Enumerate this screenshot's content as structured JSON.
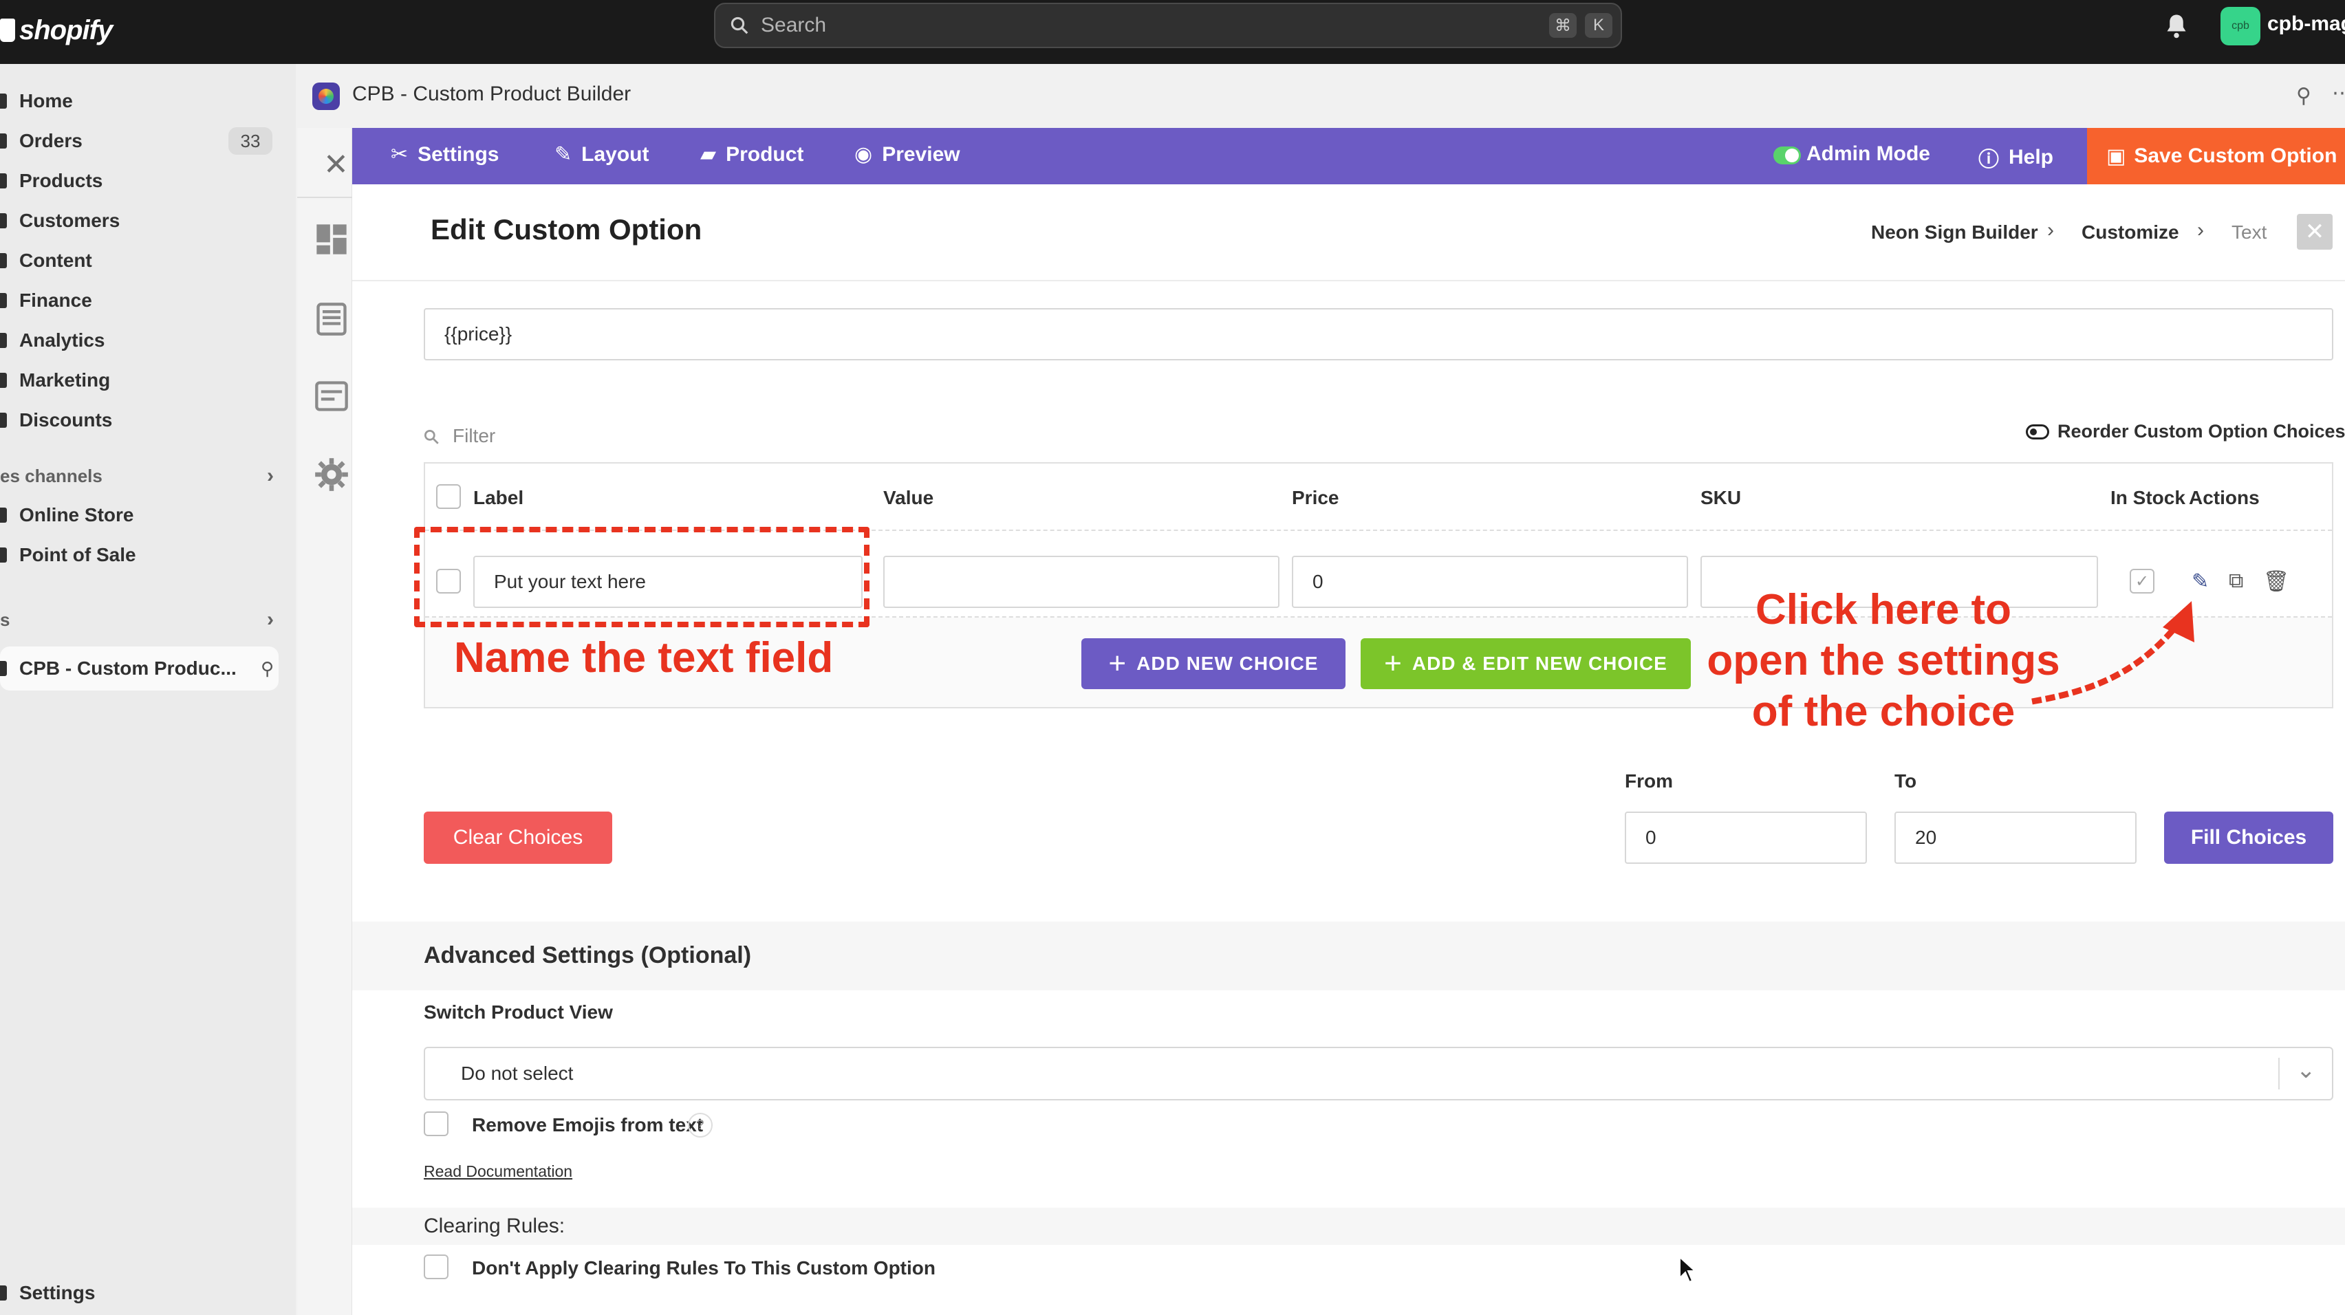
{
  "topbar": {
    "logo": "shopify",
    "search_placeholder": "Search",
    "shortcut_keys": [
      "⌘",
      "K"
    ],
    "avatar_initials": "cpb",
    "store_name": "cpb-mago"
  },
  "nav": {
    "items": [
      {
        "label": "Home"
      },
      {
        "label": "Orders",
        "badge": "33"
      },
      {
        "label": "Products"
      },
      {
        "label": "Customers"
      },
      {
        "label": "Content"
      },
      {
        "label": "Finance"
      },
      {
        "label": "Analytics"
      },
      {
        "label": "Marketing"
      },
      {
        "label": "Discounts"
      }
    ],
    "sales_channels_label": "es channels",
    "channels": [
      {
        "label": "Online Store"
      },
      {
        "label": "Point of Sale"
      }
    ],
    "apps_label": "s",
    "app_item": "CPB - Custom Produc...",
    "settings": "Settings"
  },
  "app_header": {
    "title": "CPB - Custom Product Builder"
  },
  "toolbar": {
    "settings": "Settings",
    "layout": "Layout",
    "product": "Product",
    "preview": "Preview",
    "admin_mode": "Admin Mode",
    "help": "Help",
    "save": "Save Custom Option",
    "accent": "#6c5bc4",
    "save_color": "#f7622d"
  },
  "page": {
    "title": "Edit Custom Option",
    "breadcrumb": [
      "Neon Sign Builder",
      "Customize",
      "Text"
    ],
    "price_template": "{{price}}",
    "filter_placeholder": "Filter",
    "reorder_label": "Reorder Custom Option Choices"
  },
  "choices_table": {
    "columns": [
      "Label",
      "Value",
      "Price",
      "SKU",
      "In Stock",
      "Actions"
    ],
    "rows": [
      {
        "label": "Put your text here",
        "value": "",
        "price": "0",
        "sku": "",
        "in_stock": "✓"
      }
    ],
    "add_new": "ADD NEW CHOICE",
    "add_edit_new": "ADD & EDIT NEW CHOICE"
  },
  "fill": {
    "from_label": "From",
    "to_label": "To",
    "from_value": "0",
    "to_value": "20",
    "clear_button": "Clear Choices",
    "fill_button": "Fill Choices"
  },
  "advanced": {
    "title": "Advanced Settings (Optional)",
    "switch_view_label": "Switch Product View",
    "switch_view_value": "Do not select",
    "remove_emojis": "Remove Emojis from text",
    "help_mark": "?",
    "read_doc": "Read Documentation",
    "clearing_rules": "Clearing Rules:",
    "dont_apply": "Don't Apply Clearing Rules To This Custom Option"
  },
  "annotations": {
    "name_field": "Name the text field",
    "click_here_line1": "Click here to",
    "click_here_line2": "open the settings",
    "click_here_line3": "of the choice",
    "color": "#e8331f"
  }
}
